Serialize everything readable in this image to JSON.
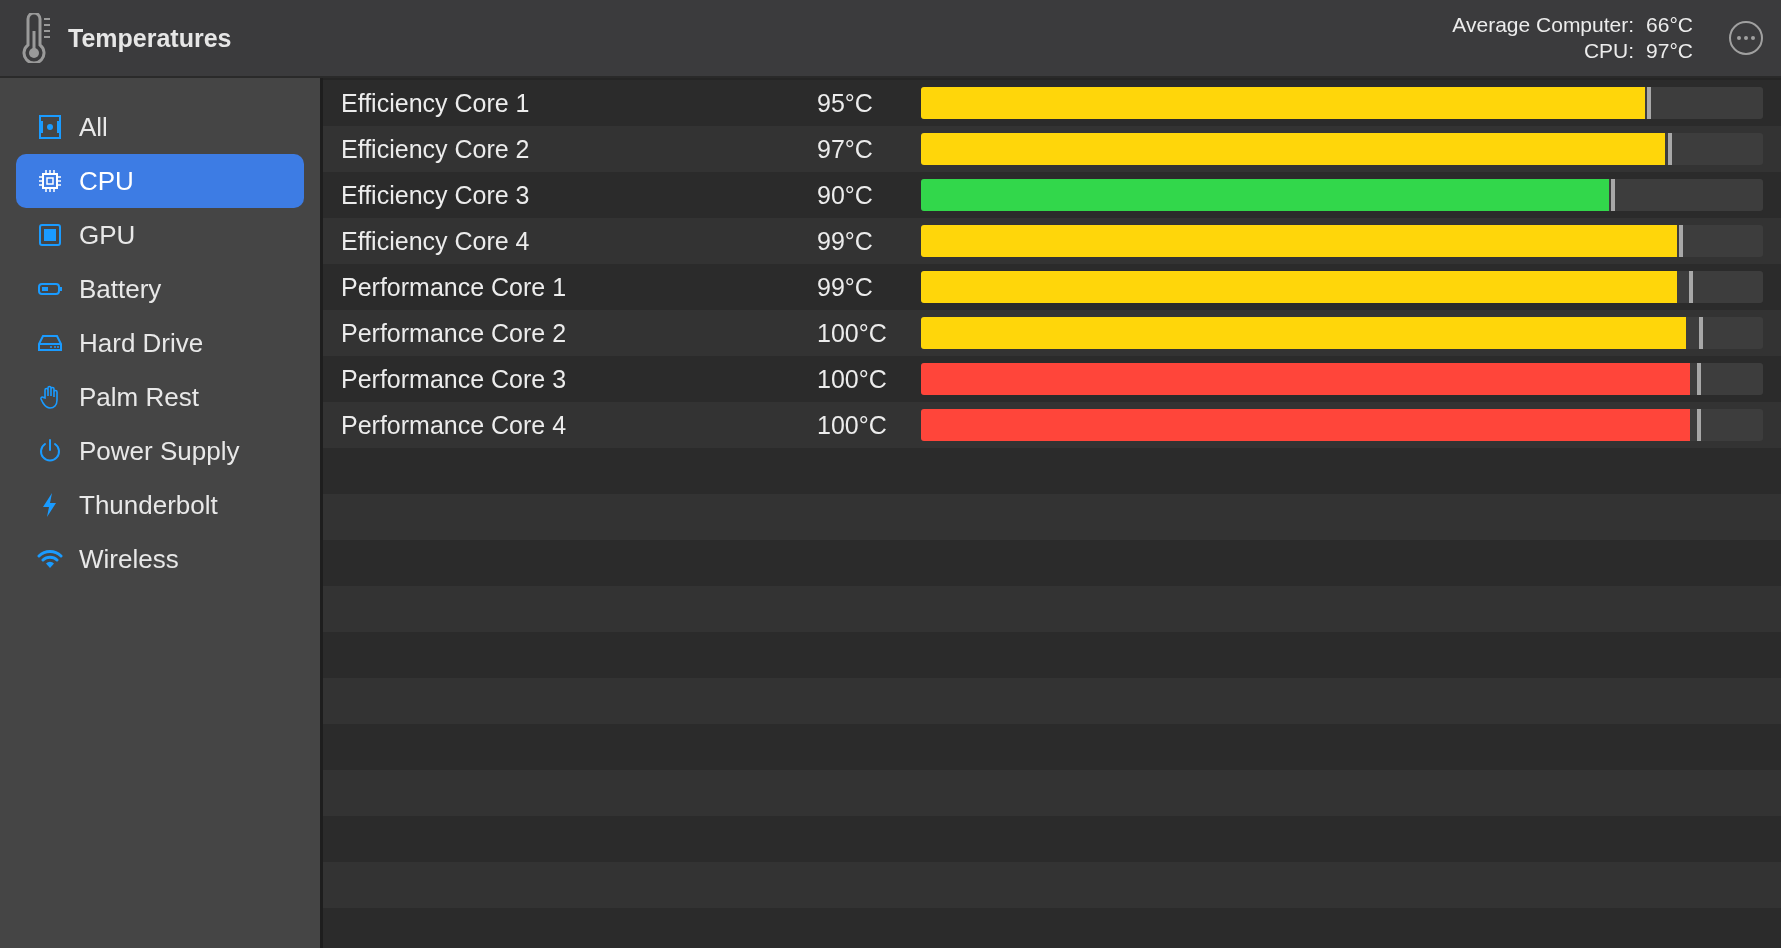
{
  "window": {
    "title": "Temperatures"
  },
  "summary": [
    {
      "label": "Average Computer:",
      "value": "66°C"
    },
    {
      "label": "CPU:",
      "value": "97°C"
    }
  ],
  "sidebar": {
    "items": [
      {
        "label": "All",
        "selected": false
      },
      {
        "label": "CPU",
        "selected": true
      },
      {
        "label": "GPU",
        "selected": false
      },
      {
        "label": "Battery",
        "selected": false
      },
      {
        "label": "Hard Drive",
        "selected": false
      },
      {
        "label": "Palm Rest",
        "selected": false
      },
      {
        "label": "Power Supply",
        "selected": false
      },
      {
        "label": "Thunderbolt",
        "selected": false
      },
      {
        "label": "Wireless",
        "selected": false
      }
    ]
  },
  "sensors": [
    {
      "name": "Efficiency Core 1",
      "reading": "95°C",
      "level": 0.86,
      "color": "#ffd60a",
      "peak": {
        "level": 0.865
      }
    },
    {
      "name": "Efficiency Core 2",
      "reading": "97°C",
      "level": 0.884,
      "color": "#ffd60a",
      "peak": {
        "level": 0.889
      }
    },
    {
      "name": "Efficiency Core 3",
      "reading": "90°C",
      "level": 0.817,
      "color": "#32d74b",
      "peak": {
        "level": 0.822
      }
    },
    {
      "name": "Efficiency Core 4",
      "reading": "99°C",
      "level": 0.898,
      "color": "#ffd60a",
      "peak": {
        "level": 0.903
      }
    },
    {
      "name": "Performance Core 1",
      "reading": "99°C",
      "level": 0.898,
      "color": "#ffd60a",
      "peak": {
        "level": 0.914
      }
    },
    {
      "name": "Performance Core 2",
      "reading": "100°C",
      "level": 0.908,
      "color": "#ffd60a",
      "peak": {
        "level": 0.926
      }
    },
    {
      "name": "Performance Core 3",
      "reading": "100°C",
      "level": 0.913,
      "color": "#ff453a",
      "peak": {
        "level": 0.924
      }
    },
    {
      "name": "Performance Core 4",
      "reading": "100°C",
      "level": 0.913,
      "color": "#ff453a",
      "peak": {
        "level": 0.924
      }
    }
  ]
}
